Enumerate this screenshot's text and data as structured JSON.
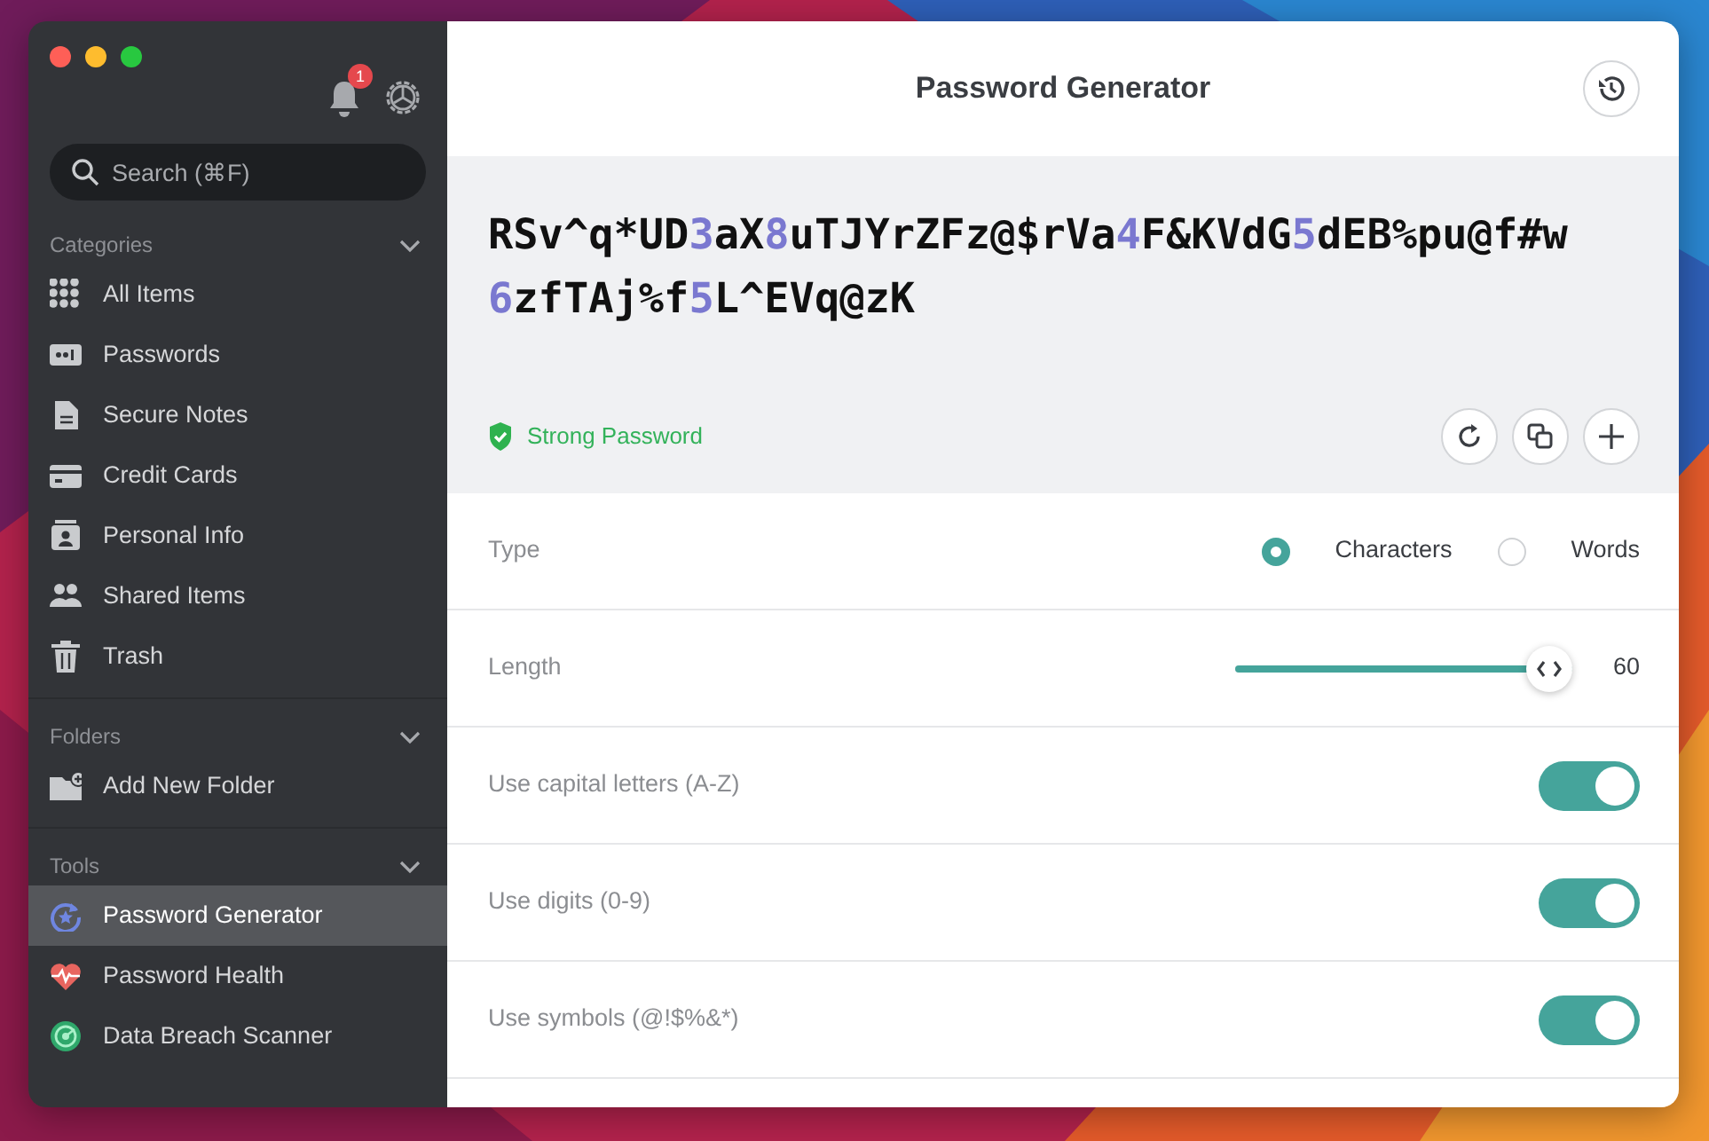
{
  "sidebar": {
    "notification_count": "1",
    "search": {
      "placeholder": "Search (⌘F)"
    },
    "sections": [
      {
        "title": "Categories",
        "expanded": true,
        "items": [
          {
            "label": "All Items",
            "selected": false
          },
          {
            "label": "Passwords",
            "selected": false
          },
          {
            "label": "Secure Notes",
            "selected": false
          },
          {
            "label": "Credit Cards",
            "selected": false
          },
          {
            "label": "Personal Info",
            "selected": false
          },
          {
            "label": "Shared Items",
            "selected": false
          },
          {
            "label": "Trash",
            "selected": false
          }
        ]
      },
      {
        "title": "Folders",
        "expanded": true,
        "items": [
          {
            "label": "Add New Folder",
            "selected": false
          }
        ]
      },
      {
        "title": "Tools",
        "expanded": true,
        "items": [
          {
            "label": "Password Generator",
            "selected": true
          },
          {
            "label": "Password Health",
            "selected": false
          },
          {
            "label": "Data Breach Scanner",
            "selected": false
          }
        ]
      }
    ]
  },
  "main": {
    "title": "Password Generator",
    "password": [
      {
        "text": "RSv^q*UD",
        "kind": "chars"
      },
      {
        "text": "3",
        "kind": "digit"
      },
      {
        "text": "aX",
        "kind": "chars"
      },
      {
        "text": "8",
        "kind": "digit"
      },
      {
        "text": "uTJYrZFz@$rVa",
        "kind": "chars"
      },
      {
        "text": "4",
        "kind": "digit"
      },
      {
        "text": "F&KVdG",
        "kind": "chars"
      },
      {
        "text": "5",
        "kind": "digit"
      },
      {
        "text": "dEB%pu@f#w",
        "kind": "chars"
      },
      {
        "text": "6",
        "kind": "digit"
      },
      {
        "text": "zfTAj%f",
        "kind": "chars"
      },
      {
        "text": "5",
        "kind": "digit"
      },
      {
        "text": "L^EVq@zK",
        "kind": "chars"
      }
    ],
    "strength": "Strong Password",
    "settings": [
      {
        "kind": "radio",
        "label": "Type",
        "options": [
          {
            "label": "Characters",
            "selected": true
          },
          {
            "label": "Words",
            "selected": false
          }
        ]
      },
      {
        "kind": "slider",
        "label": "Length",
        "level": 1,
        "reading": "60"
      },
      {
        "kind": "toggle",
        "label": "Use capital letters (A-Z)",
        "on": true
      },
      {
        "kind": "toggle",
        "label": "Use digits (0-9)",
        "on": true
      },
      {
        "kind": "toggle",
        "label": "Use symbols (@!$%&*)",
        "on": true
      }
    ]
  }
}
